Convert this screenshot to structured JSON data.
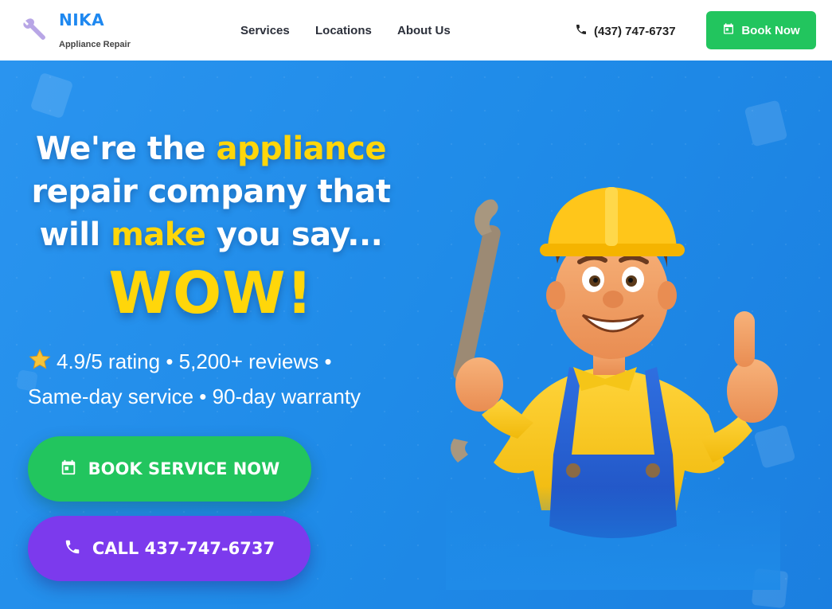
{
  "brand": {
    "name": "NIKA",
    "subtitle": "Appliance Repair",
    "logo_icon": "wrench-icon"
  },
  "nav": {
    "items": [
      {
        "label": "Services"
      },
      {
        "label": "Locations"
      },
      {
        "label": "About Us"
      }
    ]
  },
  "header": {
    "phone": "(437) 747-6737",
    "phone_icon": "phone-icon",
    "book_label": "Book Now",
    "book_icon": "calendar-icon"
  },
  "hero": {
    "line1_a": "We're the ",
    "line1_b": "appliance",
    "line2": "repair company that",
    "line3_a": "will ",
    "line3_b": "make",
    "line3_c": " you say...",
    "wow": "WOW!",
    "stats_line1": "4.9/5 rating • 5,200+ reviews •",
    "stats_line2": "Same-day service • 90-day warranty",
    "star_icon": "star-icon",
    "cta_book": "BOOK SERVICE NOW",
    "cta_call": "CALL 437-747-6737"
  },
  "colors": {
    "accent_blue": "#1f8be8",
    "green": "#22c55e",
    "purple": "#7c3aed",
    "yellow": "#ffd60a"
  }
}
